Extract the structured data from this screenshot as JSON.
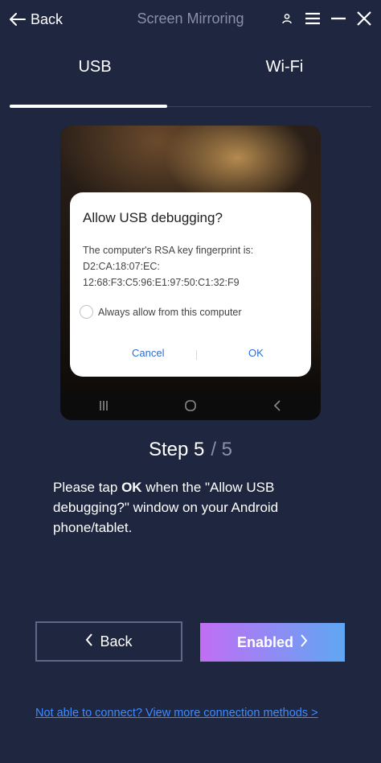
{
  "titlebar": {
    "back_label": "Back",
    "title": "Screen Mirroring",
    "controls": [
      "user-icon",
      "menu-icon",
      "minimize-icon",
      "close-icon"
    ]
  },
  "tabs": [
    {
      "label": "USB",
      "active": true
    },
    {
      "label": "Wi-Fi",
      "active": false
    }
  ],
  "phone_dialog": {
    "title": "Allow USB debugging?",
    "body_lines": [
      "The computer's RSA key fingerprint is:",
      "D2:CA:18:07:EC:",
      "12:68:F3:C5:96:E1:97:50:C1:32:F9"
    ],
    "checkbox_label": "Always allow from this computer",
    "cancel_label": "Cancel",
    "ok_label": "OK"
  },
  "step": {
    "current": "Step 5",
    "total": "/ 5"
  },
  "instruction": {
    "before": "Please tap ",
    "emphasis": "OK",
    "after": " when the \"Allow USB debugging?\" window on your Android phone/tablet."
  },
  "buttons": {
    "back_label": "Back",
    "enabled_label": "Enabled"
  },
  "help_link": "Not able to connect? View more connection methods >",
  "colors": {
    "background": "#1f2640",
    "link": "#3d8bff",
    "gradient_start": "#c16ef4",
    "gradient_end": "#5fa7f3"
  }
}
